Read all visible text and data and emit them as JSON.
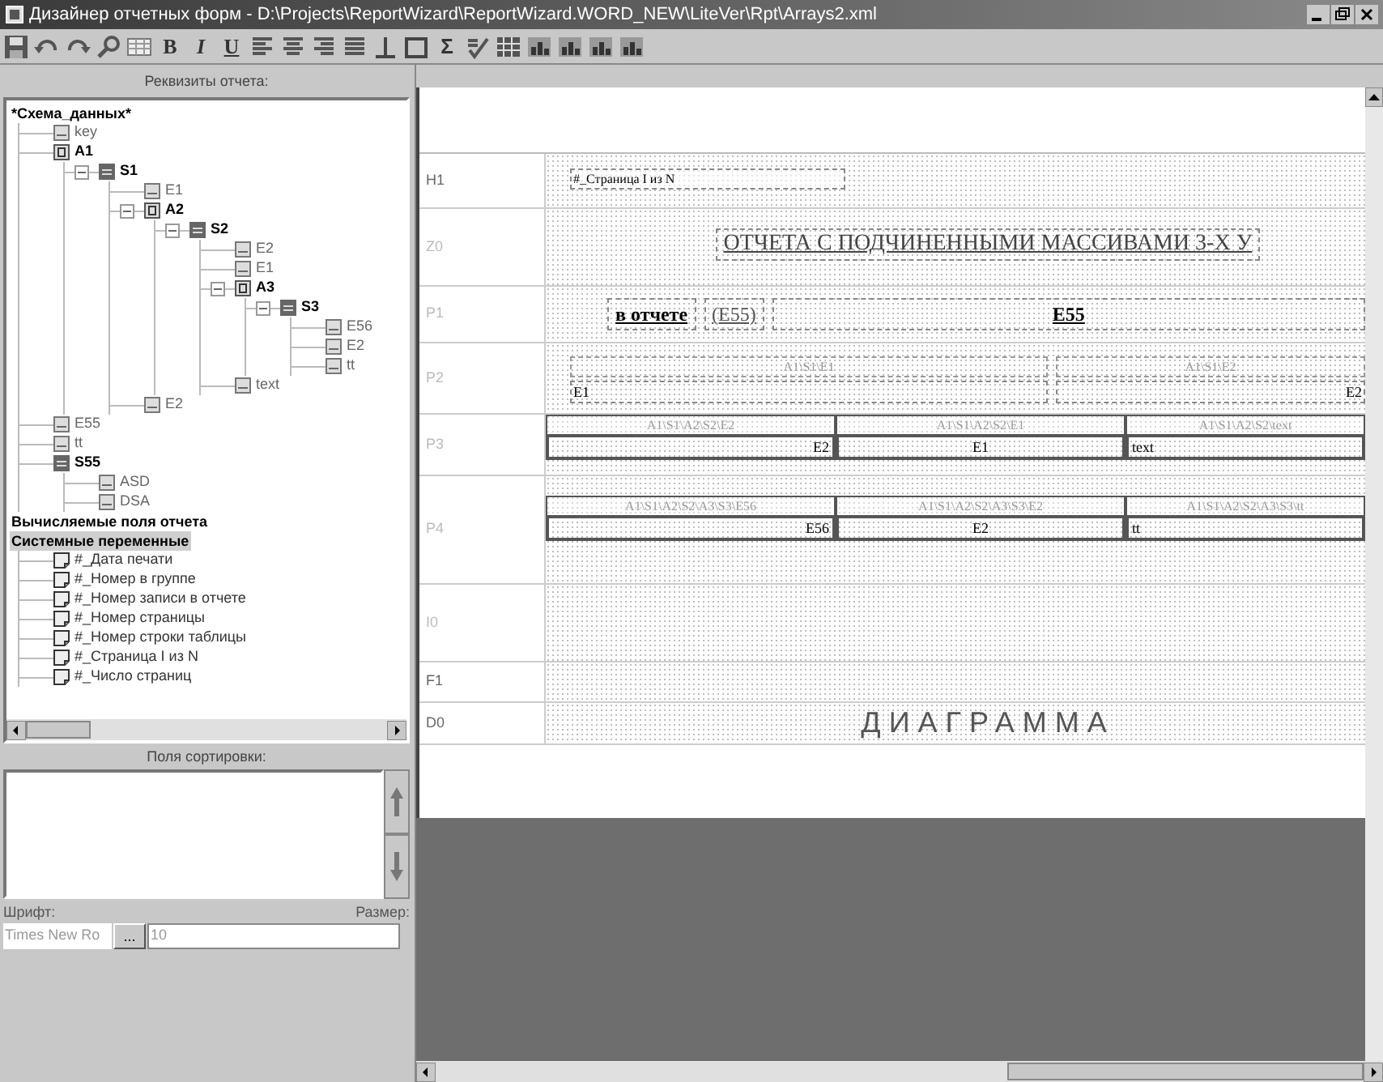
{
  "window": {
    "title": "Дизайнер отчетных форм - D:\\Projects\\ReportWizard\\ReportWizard.WORD_NEW\\LiteVer\\Rpt\\Arrays2.xml"
  },
  "toolbar": [
    {
      "kind": "save"
    },
    {
      "kind": "undo"
    },
    {
      "kind": "redo"
    },
    {
      "kind": "zoom"
    },
    {
      "kind": "table"
    },
    {
      "kind": "text",
      "label": "B"
    },
    {
      "kind": "text",
      "label": "I"
    },
    {
      "kind": "text",
      "label": "U"
    },
    {
      "kind": "align_left"
    },
    {
      "kind": "align_center"
    },
    {
      "kind": "align_right"
    },
    {
      "kind": "justify"
    },
    {
      "kind": "bottom_line"
    },
    {
      "kind": "frame"
    },
    {
      "kind": "text",
      "label": "Σ"
    },
    {
      "kind": "spell"
    },
    {
      "kind": "grid"
    },
    {
      "kind": "chart"
    },
    {
      "kind": "chart"
    },
    {
      "kind": "chart"
    },
    {
      "kind": "chart"
    }
  ],
  "requisites": {
    "title": "Реквизиты отчета:",
    "sections": [
      {
        "label": "*Схема_данных*",
        "selected": false,
        "children": [
          {
            "label": "key",
            "kind": "field"
          },
          {
            "label": "A1",
            "kind": "array",
            "children": [
              {
                "label": "S1",
                "kind": "struct",
                "expanded": true,
                "children": [
                  {
                    "label": "E1",
                    "kind": "field"
                  },
                  {
                    "label": "A2",
                    "kind": "array",
                    "expanded": true,
                    "children": [
                      {
                        "label": "S2",
                        "kind": "struct",
                        "expanded": true,
                        "children": [
                          {
                            "label": "E2",
                            "kind": "field"
                          },
                          {
                            "label": "E1",
                            "kind": "field"
                          },
                          {
                            "label": "A3",
                            "kind": "array",
                            "expanded": true,
                            "children": [
                              {
                                "label": "S3",
                                "kind": "struct",
                                "expanded": true,
                                "children": [
                                  {
                                    "label": "E56",
                                    "kind": "field"
                                  },
                                  {
                                    "label": "E2",
                                    "kind": "field"
                                  },
                                  {
                                    "label": "tt",
                                    "kind": "field"
                                  }
                                ]
                              }
                            ]
                          },
                          {
                            "label": "text",
                            "kind": "field"
                          }
                        ]
                      }
                    ]
                  },
                  {
                    "label": "E2",
                    "kind": "field"
                  }
                ]
              }
            ]
          },
          {
            "label": "E55",
            "kind": "field"
          },
          {
            "label": "tt",
            "kind": "field"
          },
          {
            "label": "S55",
            "kind": "struct",
            "children": [
              {
                "label": "ASD",
                "kind": "field"
              },
              {
                "label": "DSA",
                "kind": "field"
              }
            ]
          }
        ]
      },
      {
        "label": "Вычисляемые поля отчета",
        "selected": false
      },
      {
        "label": "Системные переменные",
        "selected": true,
        "children": [
          {
            "label": "#_Дата печати",
            "kind": "sysvar"
          },
          {
            "label": "#_Номер в группе",
            "kind": "sysvar"
          },
          {
            "label": "#_Номер записи в отчете",
            "kind": "sysvar"
          },
          {
            "label": "#_Номер страницы",
            "kind": "sysvar"
          },
          {
            "label": "#_Номер строки таблицы",
            "kind": "sysvar"
          },
          {
            "label": "#_Страница I из N",
            "kind": "sysvar"
          },
          {
            "label": "#_Число страниц",
            "kind": "sysvar"
          }
        ]
      }
    ]
  },
  "sorting": {
    "title": "Поля сортировки:"
  },
  "font": {
    "disabled": true,
    "label": "Шрифт:",
    "size_label": "Размер:",
    "value": "Times New Ro",
    "button": "...",
    "size": "10"
  },
  "bands": [
    {
      "label": "H1",
      "dimmed": false,
      "kind": "page_header",
      "text": "#_Страница I из N"
    },
    {
      "label": "Z0",
      "dimmed": true,
      "kind": "title",
      "text": "ОТЧЕТА С ПОДЧИНЕННЫМИ МАССИВАМИ 3-Х У"
    },
    {
      "label": "P1",
      "dimmed": true,
      "kind": "params",
      "texts": [
        "в отчете",
        "(E55)",
        "E55"
      ]
    },
    {
      "label": "P2",
      "dimmed": true,
      "kind": "pairs",
      "columns": [
        {
          "header": "A1\\S1\\E1",
          "value": "E1",
          "kind": "left"
        },
        {
          "header": "A1\\S1\\E2",
          "value": "E2",
          "kind": "right"
        }
      ]
    },
    {
      "label": "P3",
      "dimmed": true,
      "kind": "table",
      "columns": [
        {
          "header": "A1\\S1\\A2\\S2\\E2",
          "value": "E2",
          "kind": "right"
        },
        {
          "header": "A1\\S1\\A2\\S2\\E1",
          "value": "E1",
          "kind": "center"
        },
        {
          "header": "A1\\S1\\A2\\S2\\text",
          "value": "text",
          "kind": "left"
        }
      ]
    },
    {
      "label": "P4",
      "dimmed": true,
      "kind": "table",
      "columns": [
        {
          "header": "A1\\S1\\A2\\S2\\A3\\S3\\E56",
          "value": "E56",
          "kind": "right"
        },
        {
          "header": "A1\\S1\\A2\\S2\\A3\\S3\\E2",
          "value": "E2",
          "kind": "center"
        },
        {
          "header": "A1\\S1\\A2\\S2\\A3\\S3\\tt",
          "value": "tt",
          "kind": "left"
        }
      ]
    },
    {
      "label": "I0",
      "dimmed": true,
      "kind": "empty"
    },
    {
      "label": "F1",
      "dimmed": false,
      "kind": "empty"
    },
    {
      "label": "D0",
      "dimmed": false,
      "kind": "chart",
      "text": "ДИАГРАММА"
    }
  ]
}
